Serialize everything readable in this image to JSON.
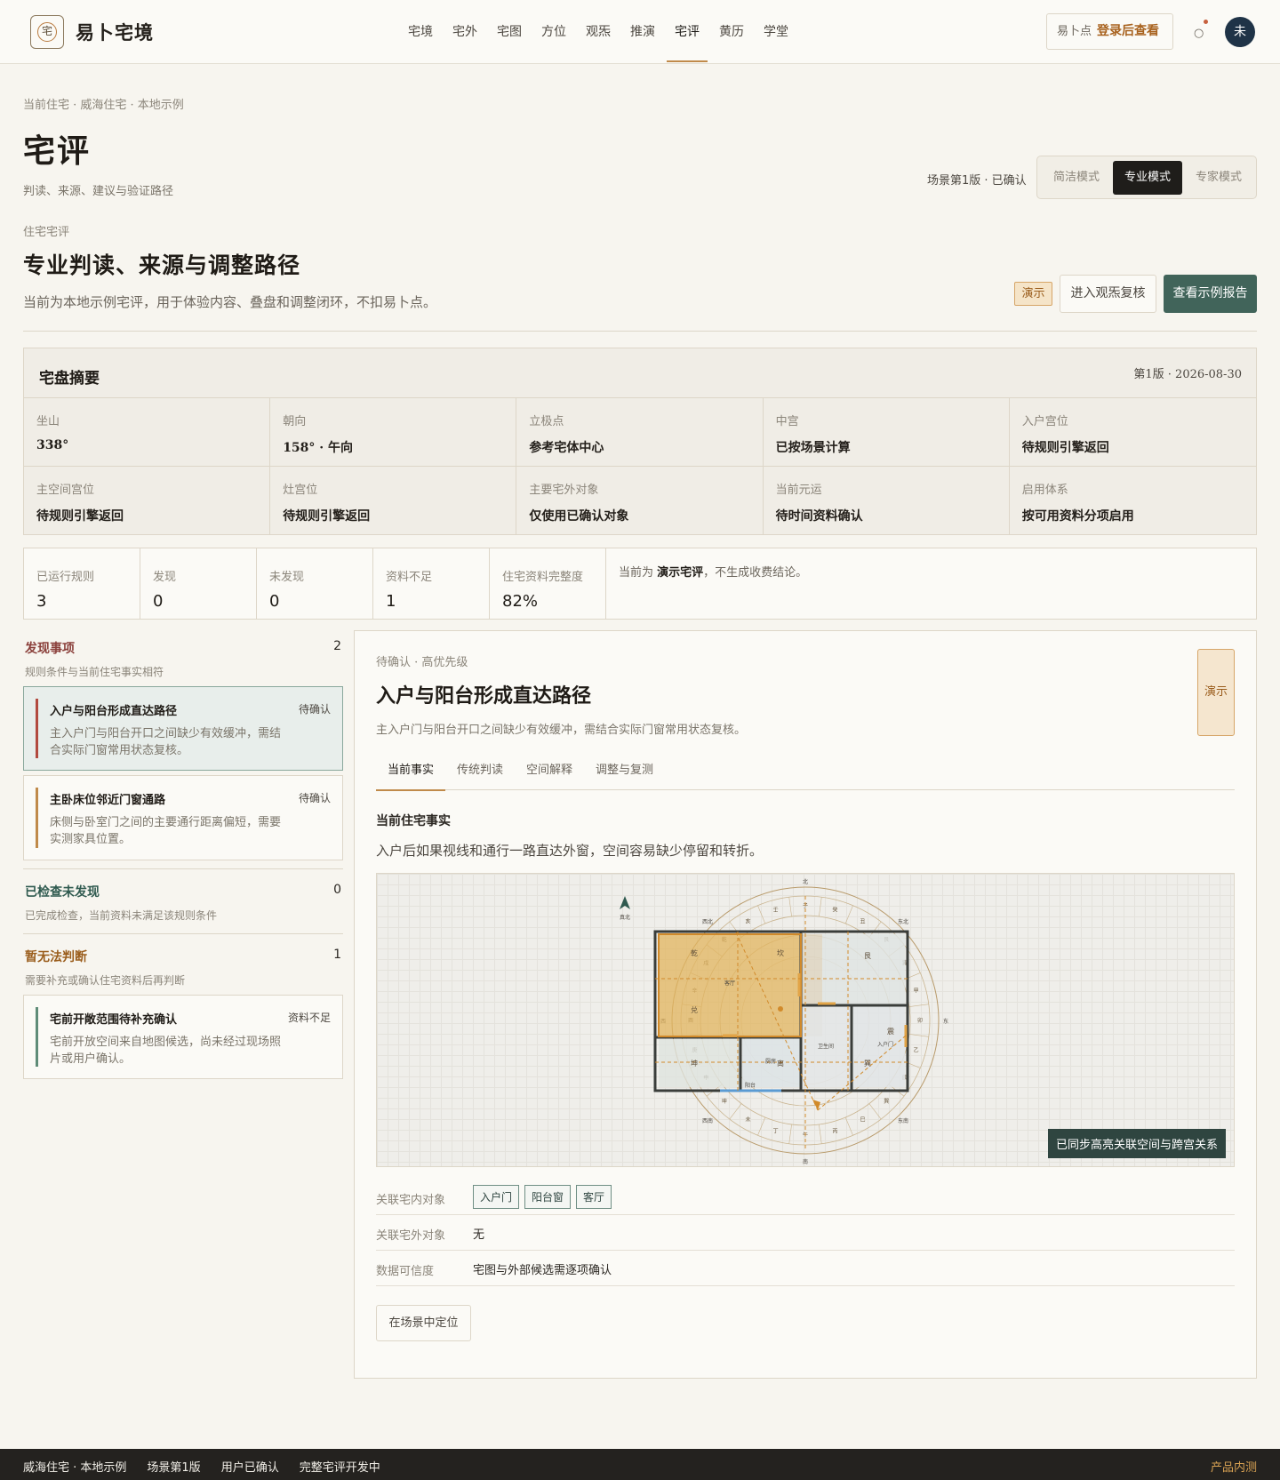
{
  "header": {
    "logo_glyph": "宅",
    "brand": "易卜宅境",
    "nav": [
      {
        "label": "宅境",
        "active": false
      },
      {
        "label": "宅外",
        "active": false
      },
      {
        "label": "宅图",
        "active": false
      },
      {
        "label": "方位",
        "active": false
      },
      {
        "label": "观炁",
        "active": false
      },
      {
        "label": "推演",
        "active": false
      },
      {
        "label": "宅评",
        "active": true
      },
      {
        "label": "黄历",
        "active": false
      },
      {
        "label": "学堂",
        "active": false
      }
    ],
    "points_label": "易卜点",
    "points_action": "登录后查看",
    "notification_glyph": "○",
    "avatar_text": "未"
  },
  "page": {
    "breadcrumb": "当前住宅 · 威海住宅 · 本地示例",
    "title": "宅评",
    "subtitle": "判读、来源、建议与验证路径",
    "scene_version": "场景第1版 · 已确认",
    "modes": [
      "简洁模式",
      "专业模式",
      "专家模式"
    ],
    "active_mode": "专业模式",
    "section_label": "住宅宅评",
    "section_title": "专业判读、来源与调整路径",
    "section_desc": "当前为本地示例宅评，用于体验内容、叠盘和调整闭环，不扣易卜点。",
    "demo_tag": "演示",
    "review_button": "进入观炁复核",
    "report_button": "查看示例报告"
  },
  "summary": {
    "title": "宅盘摘要",
    "version": "第1版 · 2026-08-30",
    "cells": [
      {
        "label": "坐山",
        "value": "338°"
      },
      {
        "label": "朝向",
        "value": "158° · 午向"
      },
      {
        "label": "立极点",
        "value": "参考宅体中心"
      },
      {
        "label": "中宫",
        "value": "已按场景计算"
      },
      {
        "label": "入户宫位",
        "value": "待规则引擎返回"
      },
      {
        "label": "主空间宫位",
        "value": "待规则引擎返回"
      },
      {
        "label": "灶宫位",
        "value": "待规则引擎返回"
      },
      {
        "label": "主要宅外对象",
        "value": "仅使用已确认对象"
      },
      {
        "label": "当前元运",
        "value": "待时间资料确认"
      },
      {
        "label": "启用体系",
        "value": "按可用资料分项启用"
      }
    ]
  },
  "stats": {
    "items": [
      {
        "label": "已运行规则",
        "value": "3"
      },
      {
        "label": "发现",
        "value": "0"
      },
      {
        "label": "未发现",
        "value": "0"
      },
      {
        "label": "资料不足",
        "value": "1"
      },
      {
        "label": "住宅资料完整度",
        "value": "82%"
      }
    ],
    "note_prefix": "当前为",
    "note_bold": "演示宅评",
    "note_suffix": "，不生成收费结论。"
  },
  "findings": {
    "found": {
      "title": "发现事项",
      "count": "2",
      "desc": "规则条件与当前住宅事实相符",
      "color": "#8a3f3a"
    },
    "cards": [
      {
        "title": "入户与阳台形成直达路径",
        "status": "待确认",
        "desc": "主入户门与阳台开口之间缺少有效缓冲，需结合实际门窗常用状态复核。",
        "bar": "#b24a3f"
      },
      {
        "title": "主卧床位邻近门窗通路",
        "status": "待确认",
        "desc": "床侧与卧室门之间的主要通行距离偏短，需要实测家具位置。",
        "bar": "#c08a4a"
      }
    ],
    "not_found": {
      "title": "已检查未发现",
      "count": "0",
      "desc": "已完成检查，当前资料未满足该规则条件",
      "color": "#2f5a4f"
    },
    "insufficient": {
      "title": "暂无法判断",
      "count": "1",
      "desc": "需要补充或确认住宅资料后再判断",
      "color": "#9a5d1c"
    },
    "insufficient_card": {
      "title": "宅前开敞范围待补充确认",
      "status": "资料不足",
      "desc": "宅前开放空间来自地图候选，尚未经过现场照片或用户确认。",
      "bar": "#5f8c78"
    }
  },
  "detail": {
    "label": "待确认 · 高优先级",
    "title": "入户与阳台形成直达路径",
    "desc": "主入户门与阳台开口之间缺少有效缓冲，需结合实际门窗常用状态复核。",
    "demo": "演示",
    "tabs": [
      "当前事实",
      "传统判读",
      "空间解释",
      "调整与复测"
    ],
    "active_tab": "当前事实",
    "fact_title": "当前住宅事实",
    "fact_text": "入户后如果视线和通行一路直达外窗，空间容易缺少停留和转折。",
    "plan": {
      "north_label": "真北",
      "dirs": {
        "n": "北",
        "s": "南",
        "e": "东",
        "w": "西",
        "ne": "东北",
        "nw": "西北",
        "se": "东南",
        "sw": "西南"
      },
      "ring": [
        "壬",
        "子",
        "癸",
        "丑",
        "艮",
        "寅",
        "甲",
        "卯",
        "乙",
        "辰",
        "巽",
        "巳",
        "丙",
        "午",
        "丁",
        "未",
        "坤",
        "申",
        "庚",
        "酉",
        "辛",
        "戌",
        "乾",
        "亥"
      ],
      "palaces": [
        "乾",
        "坎",
        "艮",
        "兑",
        "震",
        "坤",
        "离",
        "巽"
      ],
      "rooms": [
        "客厅",
        "厨房",
        "阳台",
        "卫生间",
        "入户门"
      ],
      "badge": "已同步高亮关联空间与跨宫关系"
    },
    "relations": [
      {
        "label": "关联宅内对象",
        "chips": [
          "入户门",
          "阳台窗",
          "客厅"
        ]
      },
      {
        "label": "关联宅外对象",
        "value": "无"
      },
      {
        "label": "数据可信度",
        "value": "宅图与外部候选需逐项确认"
      }
    ],
    "locate_button": "在场景中定位"
  },
  "footer": {
    "items": [
      "威海住宅 · 本地示例",
      "场景第1版",
      "用户已确认",
      "完整宅评开发中"
    ],
    "beta": "产品内测"
  }
}
